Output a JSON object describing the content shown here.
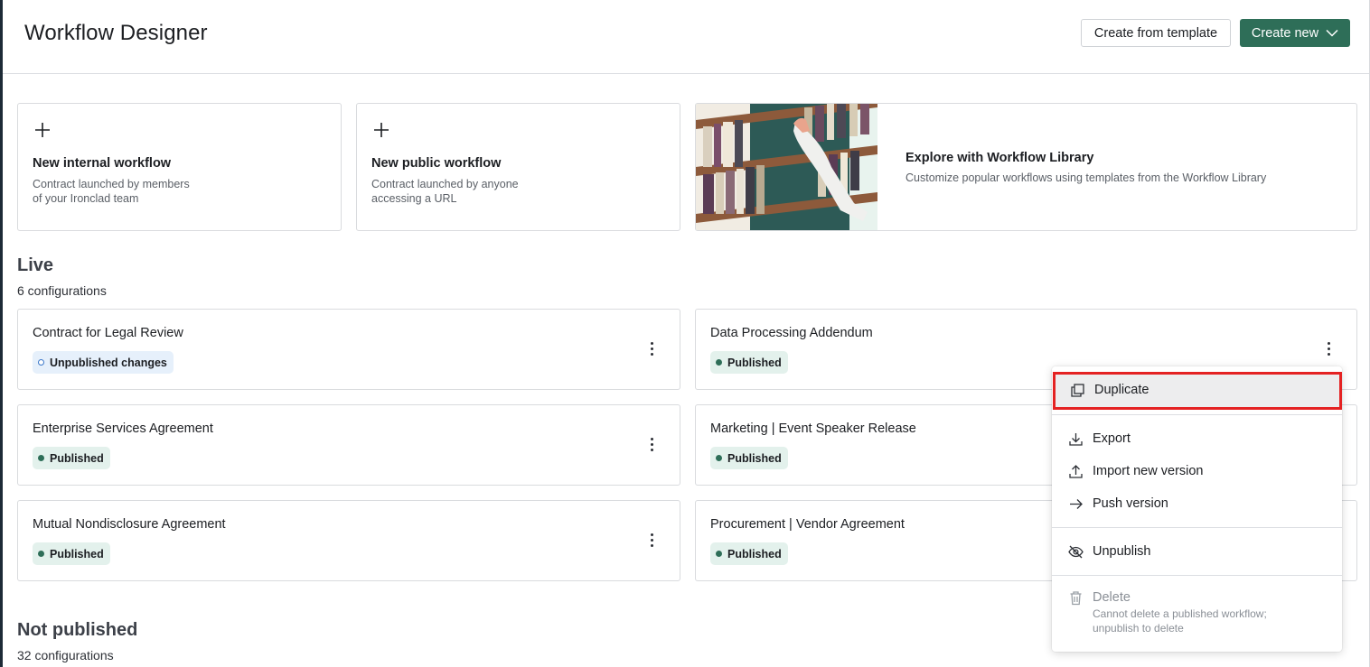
{
  "header": {
    "title": "Workflow Designer",
    "create_from_template_label": "Create from template",
    "create_new_label": "Create new"
  },
  "quick_actions": [
    {
      "title": "New internal workflow",
      "description": "Contract launched by members of your Ironclad team"
    },
    {
      "title": "New public workflow",
      "description": "Contract launched by anyone accessing a URL"
    }
  ],
  "library": {
    "title": "Explore with Workflow Library",
    "description": "Customize popular workflows using templates from the Workflow Library"
  },
  "live": {
    "title": "Live",
    "count": "6 configurations",
    "workflows": [
      {
        "name": "Contract for Legal Review",
        "status": "Unpublished changes"
      },
      {
        "name": "Data Processing Addendum",
        "status": "Published"
      },
      {
        "name": "Enterprise Services Agreement",
        "status": "Published"
      },
      {
        "name": "Marketing | Event Speaker Release",
        "status": "Published"
      },
      {
        "name": "Mutual Nondisclosure Agreement",
        "status": "Published"
      },
      {
        "name": "Procurement | Vendor Agreement",
        "status": "Published"
      }
    ]
  },
  "not_published": {
    "title": "Not published",
    "count": "32 configurations"
  },
  "menu": {
    "duplicate": "Duplicate",
    "export": "Export",
    "import_new_version": "Import new version",
    "push_version": "Push version",
    "unpublish": "Unpublish",
    "delete": "Delete",
    "delete_hint": "Cannot delete a published workflow; unpublish to delete"
  },
  "colors": {
    "brand_green": "#2e6e58",
    "published_bg": "#e3f1ec",
    "unpublished_bg": "#e6f0fb",
    "highlight_red": "#e42222"
  }
}
